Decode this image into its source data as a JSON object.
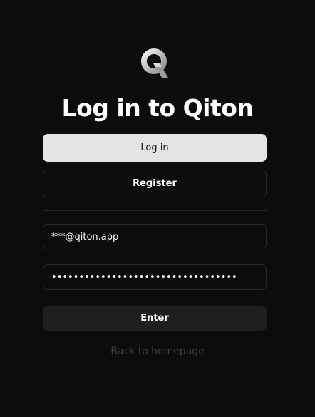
{
  "brand": {
    "logo_icon": "qiton-q-logo-icon",
    "accent": "#e4e4e4"
  },
  "title": "Log in to Qiton",
  "tabs": {
    "login_label": "Log in",
    "register_label": "Register"
  },
  "form": {
    "email_value": "***@qiton.app",
    "password_value": "••••••••••••••••••••••••••••••••••",
    "submit_label": "Enter"
  },
  "footer": {
    "back_label": "Back to homepage"
  }
}
